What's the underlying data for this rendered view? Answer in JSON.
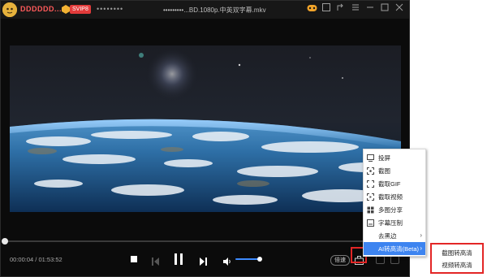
{
  "titlebar": {
    "account_name": "DDDDDD...",
    "vip_badge": "SVIP8",
    "file_title": "•••••••••...BD.1080p.中英双字幕.mkv",
    "tab_icons": "••••••••"
  },
  "player": {
    "current_time": "00:00:04",
    "separator": "/",
    "total_time": "01:53:52",
    "speed_label": "倍速",
    "progress": 0.0,
    "volume": 0.7
  },
  "context_menu": {
    "items": [
      {
        "label": "投屏",
        "icon": "cast-icon"
      },
      {
        "label": "截图",
        "icon": "screenshot-icon"
      },
      {
        "label": "截取GIF",
        "icon": "gif-icon"
      },
      {
        "label": "截取视频",
        "icon": "video-clip-icon"
      },
      {
        "label": "多图分享",
        "icon": "multi-image-icon"
      },
      {
        "label": "字幕压制",
        "icon": "subtitle-icon"
      },
      {
        "label": "去黑边",
        "icon": "crop-icon",
        "has_submenu": true
      },
      {
        "label": "AI转高清(Beta)",
        "active": true,
        "has_submenu": true
      }
    ]
  },
  "submenu": {
    "items": [
      {
        "label": "截图转高清"
      },
      {
        "label": "视频转高清"
      }
    ]
  },
  "colors": {
    "accent": "#3d84f0",
    "highlight_border": "#e32626",
    "player_bg": "#0b0b0b"
  }
}
